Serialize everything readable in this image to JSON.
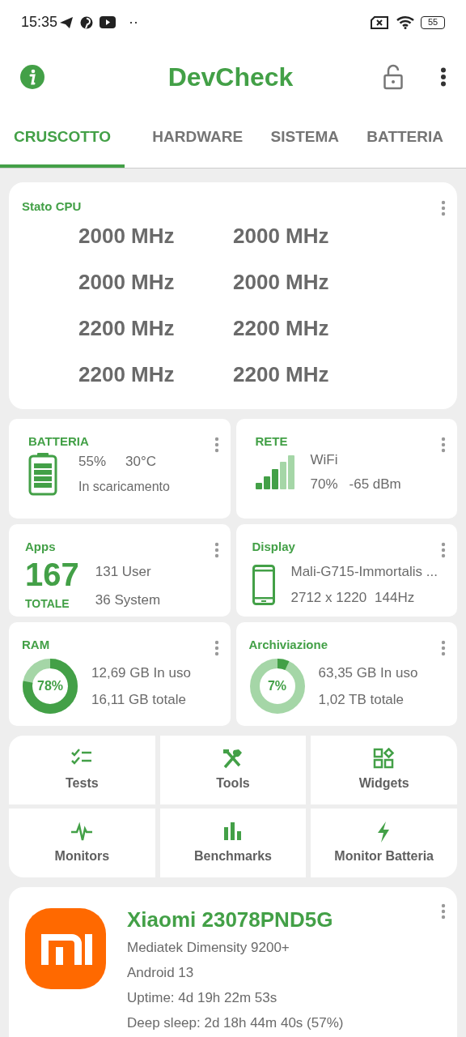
{
  "status_bar": {
    "time": "15:35",
    "dots": "··",
    "battery": "55"
  },
  "app_bar": {
    "title": "DevCheck"
  },
  "tabs": [
    {
      "label": "CRUSCOTTO",
      "selected": true
    },
    {
      "label": "HARDWARE",
      "selected": false
    },
    {
      "label": "SISTEMA",
      "selected": false
    },
    {
      "label": "BATTERIA",
      "selected": false
    }
  ],
  "cpu": {
    "title": "Stato CPU",
    "cores": [
      "2000 MHz",
      "2000 MHz",
      "2000 MHz",
      "2000 MHz",
      "2200 MHz",
      "2200 MHz",
      "2200 MHz",
      "2200 MHz"
    ]
  },
  "battery": {
    "title": "BATTERIA",
    "percent": "55%",
    "temperature": "30°C",
    "status": "In scaricamento"
  },
  "network": {
    "title": "RETE",
    "type": "WiFi",
    "signal": "70%",
    "dbm": "-65 dBm"
  },
  "apps": {
    "title": "Apps",
    "total": "167",
    "total_label": "TOTALE",
    "user": "131 User",
    "system": "36 System"
  },
  "display": {
    "title": "Display",
    "gpu": "Mali-G715-Immortalis ...",
    "resolution": "2712 x 1220",
    "refresh": "144Hz"
  },
  "ram": {
    "title": "RAM",
    "percent": "78%",
    "used": "12,69 GB In uso",
    "total": "16,11 GB totale"
  },
  "storage": {
    "title": "Archiviazione",
    "percent": "7%",
    "used": "63,35 GB In uso",
    "total": "1,02 TB totale"
  },
  "shortcuts": [
    {
      "kind": "tests",
      "label": "Tests"
    },
    {
      "kind": "tools",
      "label": "Tools"
    },
    {
      "kind": "widgets",
      "label": "Widgets"
    },
    {
      "kind": "monitors",
      "label": "Monitors"
    },
    {
      "kind": "benchmarks",
      "label": "Benchmarks"
    },
    {
      "kind": "battery",
      "label": "Monitor Batteria"
    }
  ],
  "device": {
    "name": "Xiaomi 23078PND5G",
    "chip": "Mediatek Dimensity 9200+",
    "os": "Android 13",
    "uptime": "Uptime: 4d 19h 22m 53s",
    "deep_sleep": "Deep sleep: 2d 18h 44m 40s (57%)"
  }
}
